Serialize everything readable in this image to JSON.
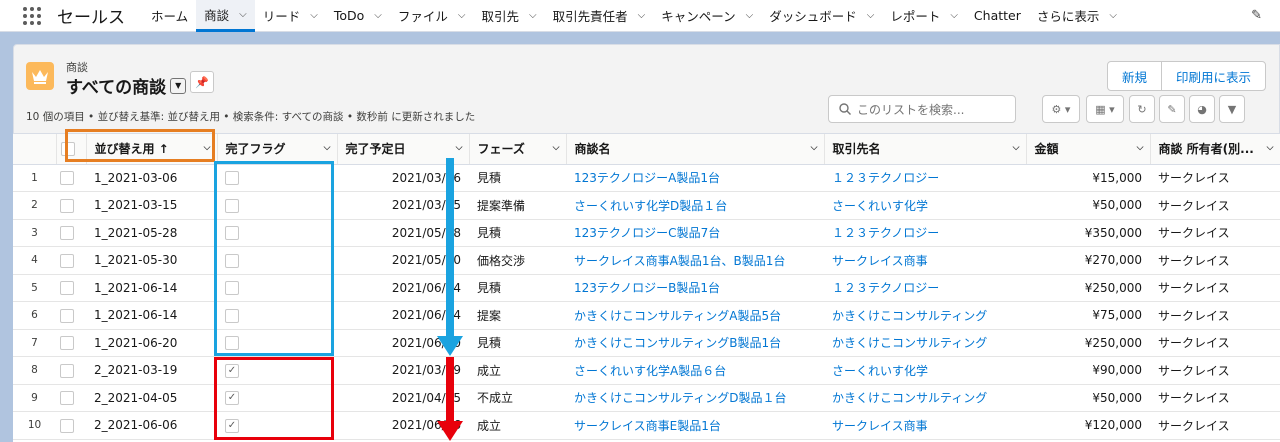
{
  "app": {
    "name": "セールス",
    "nav": [
      {
        "label": "ホーム",
        "chevron": false,
        "active": false
      },
      {
        "label": "商談",
        "chevron": true,
        "active": true
      },
      {
        "label": "リード",
        "chevron": true,
        "active": false
      },
      {
        "label": "ToDo",
        "chevron": true,
        "active": false
      },
      {
        "label": "ファイル",
        "chevron": true,
        "active": false
      },
      {
        "label": "取引先",
        "chevron": true,
        "active": false
      },
      {
        "label": "取引先責任者",
        "chevron": true,
        "active": false
      },
      {
        "label": "キャンペーン",
        "chevron": true,
        "active": false
      },
      {
        "label": "ダッシュボード",
        "chevron": true,
        "active": false
      },
      {
        "label": "レポート",
        "chevron": true,
        "active": false
      },
      {
        "label": "Chatter",
        "chevron": false,
        "active": false
      },
      {
        "label": "さらに表示",
        "chevron": true,
        "active": false
      }
    ]
  },
  "list": {
    "object_label": "商談",
    "title": "すべての商談",
    "buttons": {
      "new": "新規",
      "print": "印刷用に表示"
    },
    "meta": "10 個の項目 • 並び替え基準: 並び替え用 • 検索条件: すべての商談 • 数秒前 に更新されました",
    "search_placeholder": "このリストを検索..."
  },
  "table": {
    "columns": [
      "並び替え用 ↑",
      "完了フラグ",
      "完了予定日",
      "フェーズ",
      "商談名",
      "取引先名",
      "金額",
      "商談 所有者(別..."
    ],
    "rows": [
      {
        "n": "1",
        "sort": "1_2021-03-06",
        "done": false,
        "date": "2021/03/06",
        "phase": "見積",
        "name": "123テクノロジーA製品1台",
        "account": "１２３テクノロジー",
        "amount": "¥15,000",
        "owner": "サークレイス"
      },
      {
        "n": "2",
        "sort": "1_2021-03-15",
        "done": false,
        "date": "2021/03/15",
        "phase": "提案準備",
        "name": "さーくれいす化学D製品１台",
        "account": "さーくれいす化学",
        "amount": "¥50,000",
        "owner": "サークレイス"
      },
      {
        "n": "3",
        "sort": "1_2021-05-28",
        "done": false,
        "date": "2021/05/28",
        "phase": "見積",
        "name": "123テクノロジーC製品7台",
        "account": "１２３テクノロジー",
        "amount": "¥350,000",
        "owner": "サークレイス"
      },
      {
        "n": "4",
        "sort": "1_2021-05-30",
        "done": false,
        "date": "2021/05/30",
        "phase": "価格交渉",
        "name": "サークレイス商事A製品1台、B製品1台",
        "account": "サークレイス商事",
        "amount": "¥270,000",
        "owner": "サークレイス"
      },
      {
        "n": "5",
        "sort": "1_2021-06-14",
        "done": false,
        "date": "2021/06/14",
        "phase": "見積",
        "name": "123テクノロジーB製品1台",
        "account": "１２３テクノロジー",
        "amount": "¥250,000",
        "owner": "サークレイス"
      },
      {
        "n": "6",
        "sort": "1_2021-06-14",
        "done": false,
        "date": "2021/06/14",
        "phase": "提案",
        "name": "かきくけこコンサルティングA製品5台",
        "account": "かきくけこコンサルティング",
        "amount": "¥75,000",
        "owner": "サークレイス"
      },
      {
        "n": "7",
        "sort": "1_2021-06-20",
        "done": false,
        "date": "2021/06/20",
        "phase": "見積",
        "name": "かきくけこコンサルティングB製品1台",
        "account": "かきくけこコンサルティング",
        "amount": "¥250,000",
        "owner": "サークレイス"
      },
      {
        "n": "8",
        "sort": "2_2021-03-19",
        "done": true,
        "date": "2021/03/19",
        "phase": "成立",
        "name": "さーくれいす化学A製品６台",
        "account": "さーくれいす化学",
        "amount": "¥90,000",
        "owner": "サークレイス"
      },
      {
        "n": "9",
        "sort": "2_2021-04-05",
        "done": true,
        "date": "2021/04/05",
        "phase": "不成立",
        "name": "かきくけこコンサルティングD製品１台",
        "account": "かきくけこコンサルティング",
        "amount": "¥50,000",
        "owner": "サークレイス"
      },
      {
        "n": "10",
        "sort": "2_2021-06-06",
        "done": true,
        "date": "2021/06/06",
        "phase": "成立",
        "name": "サークレイス商事E製品1台",
        "account": "サークレイス商事",
        "amount": "¥120,000",
        "owner": "サークレイス"
      }
    ]
  },
  "annotations": {
    "orange": "#e67e22",
    "blue": "#1aa3e0",
    "red": "#e8000b"
  }
}
